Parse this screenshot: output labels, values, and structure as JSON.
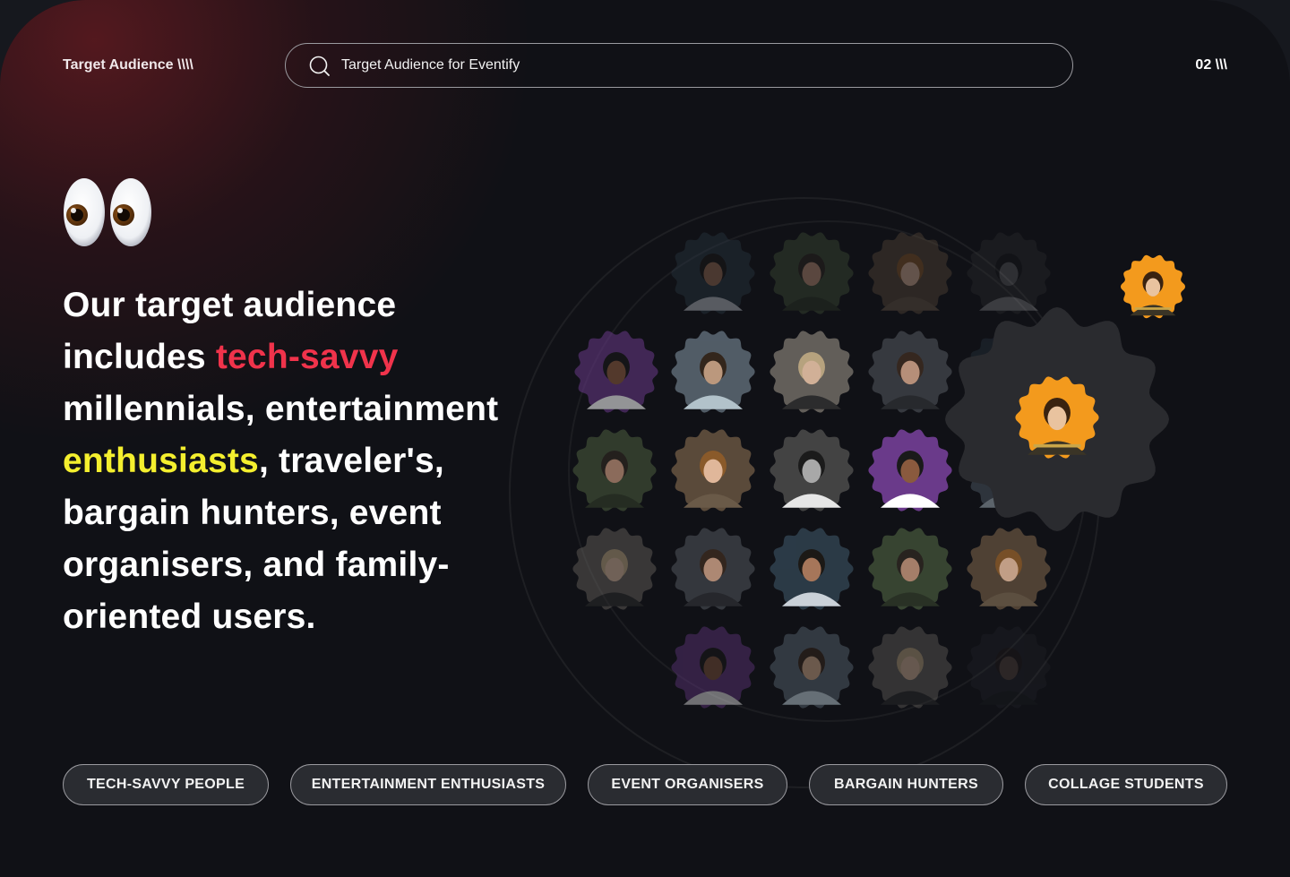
{
  "header": {
    "brand": "Target Audience \\\\\\\\",
    "search_value": "Target Audience for Eventify",
    "page_number": "02 \\\\\\"
  },
  "headline": {
    "part1": "Our target audience includes ",
    "highlight_red": "tech-savvy",
    "part2": " millennials, entertainment ",
    "highlight_yellow": "enthusiasts",
    "part3": ", traveler's, bargain hunters, event organisers, and family-oriented users."
  },
  "emoji": "eyes",
  "colors": {
    "accent_red": "#f0334b",
    "accent_yellow": "#f4ef2e",
    "featured_orange": "#f39a1d",
    "background": "#101116",
    "tag_background": "#2a2c31"
  },
  "tags": [
    "TECH-SAVVY PEOPLE",
    "ENTERTAINMENT ENTHUSIASTS",
    "EVENT ORGANISERS",
    "BARGAIN HUNTERS",
    "COLLAGE STUDENTS"
  ]
}
